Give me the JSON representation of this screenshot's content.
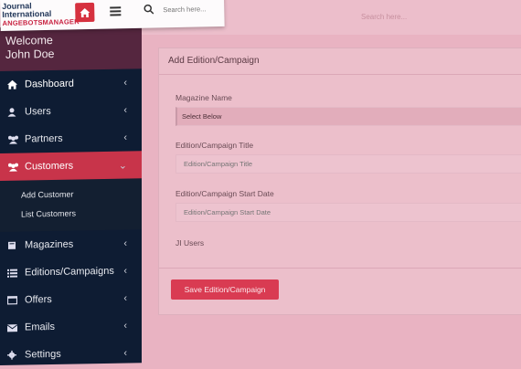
{
  "header": {
    "logo_line1": "Journal",
    "logo_line2": "International",
    "logo_line3": "ANGEBOTSMANAGER",
    "search_placeholder": "Search here...",
    "search_ghost": "Search here..."
  },
  "sidebar": {
    "welcome_line1": "Welcome",
    "welcome_line2": "John Doe",
    "items": [
      {
        "label": "Dashboard",
        "icon": "home-icon"
      },
      {
        "label": "Users",
        "icon": "user-icon"
      },
      {
        "label": "Partners",
        "icon": "users-icon"
      },
      {
        "label": "Customers",
        "icon": "users-icon",
        "active": true
      },
      {
        "label": "Magazines",
        "icon": "book-icon"
      },
      {
        "label": "Editions/Campaigns",
        "icon": "list-icon"
      },
      {
        "label": "Offers",
        "icon": "window-icon"
      },
      {
        "label": "Emails",
        "icon": "envelope-icon"
      },
      {
        "label": "Settings",
        "icon": "gear-icon"
      }
    ],
    "submenu": [
      "Add Customer",
      "List Customers"
    ]
  },
  "panel": {
    "title": "Add Edition/Campaign",
    "magazine_label": "Magazine Name",
    "magazine_value": "Select Below",
    "title_label": "Edition/Campaign Title",
    "title_placeholder": "Edition/Campaign Title",
    "date_label": "Edition/Campaign Start Date",
    "date_placeholder": "Edition/Campaign Start Date",
    "users_label": "JI Users",
    "save_label": "Save Edition/Campaign"
  },
  "colors": {
    "accent": "#c8344a",
    "sidebar_bg": "#0e1c33",
    "overlay": "#e9b3c2"
  }
}
